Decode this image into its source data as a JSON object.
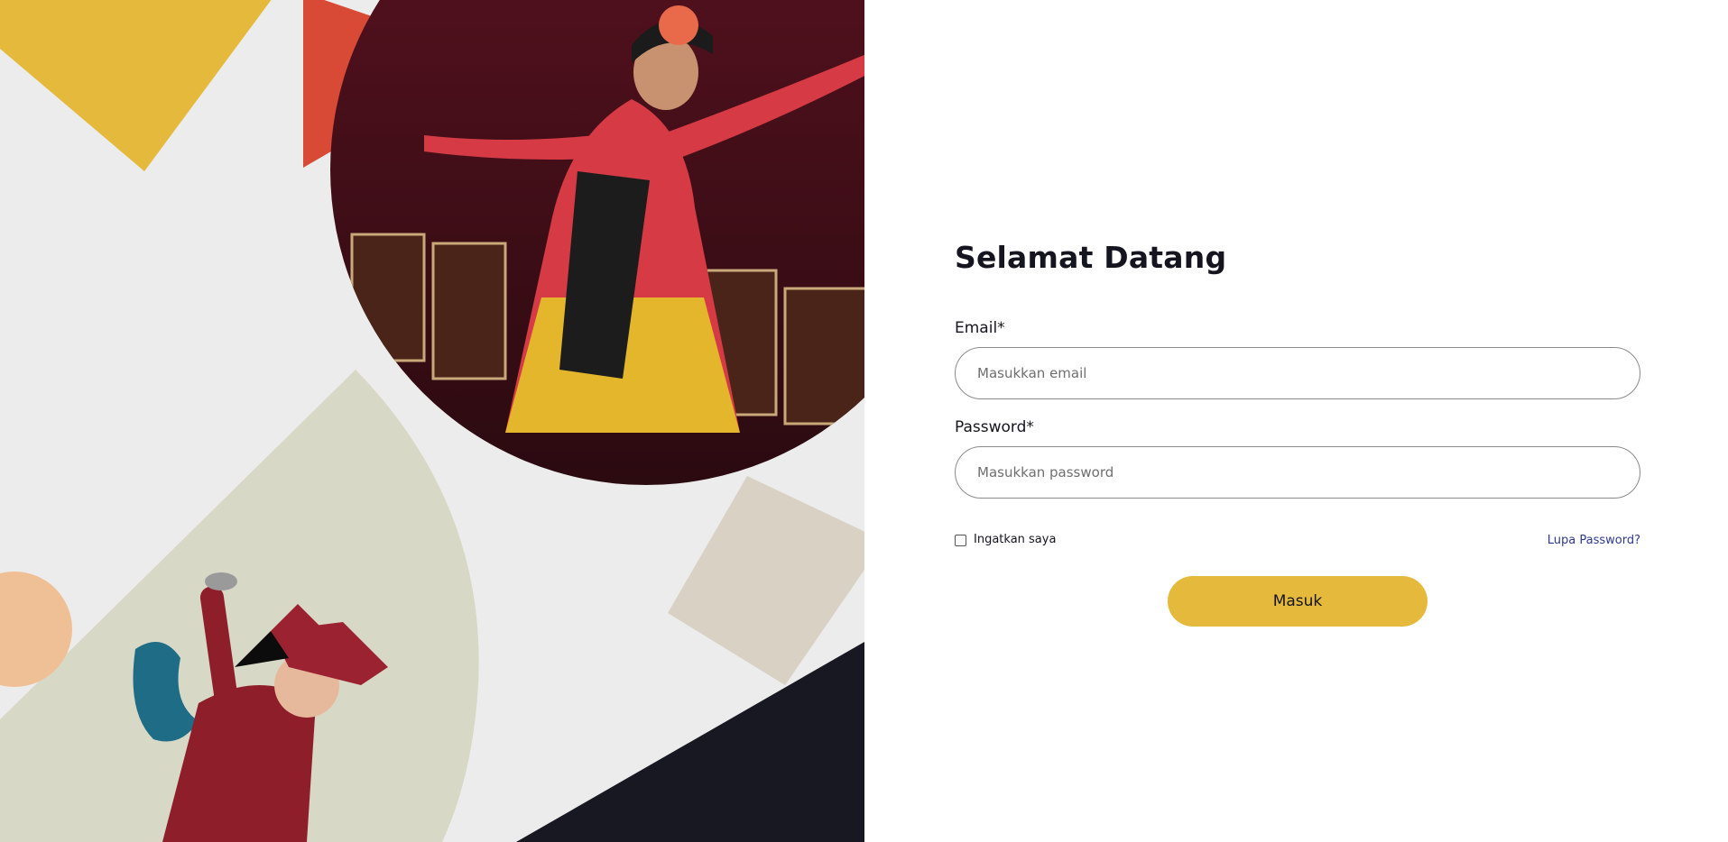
{
  "login": {
    "title": "Selamat Datang",
    "email_label": "Email*",
    "email_placeholder": "Masukkan email",
    "email_value": "",
    "password_label": "Password*",
    "password_placeholder": "Masukkan password",
    "password_value": "",
    "remember_label": "Ingatkan saya",
    "remember_checked": false,
    "forgot_label": "Lupa Password?",
    "submit_label": "Masuk"
  },
  "colors": {
    "accent_yellow": "#e4b93c",
    "accent_red": "#d84a35",
    "navy": "#171822",
    "beige": "#d8d8c6",
    "tan": "#d9d1c4",
    "peach": "#efc096",
    "link_blue": "#2f3a8f",
    "panel_gray": "#ececec"
  },
  "art": {
    "photo_subject": "dancer-in-red-costume",
    "illustration_subject": "traditional-dancer-illustration"
  }
}
